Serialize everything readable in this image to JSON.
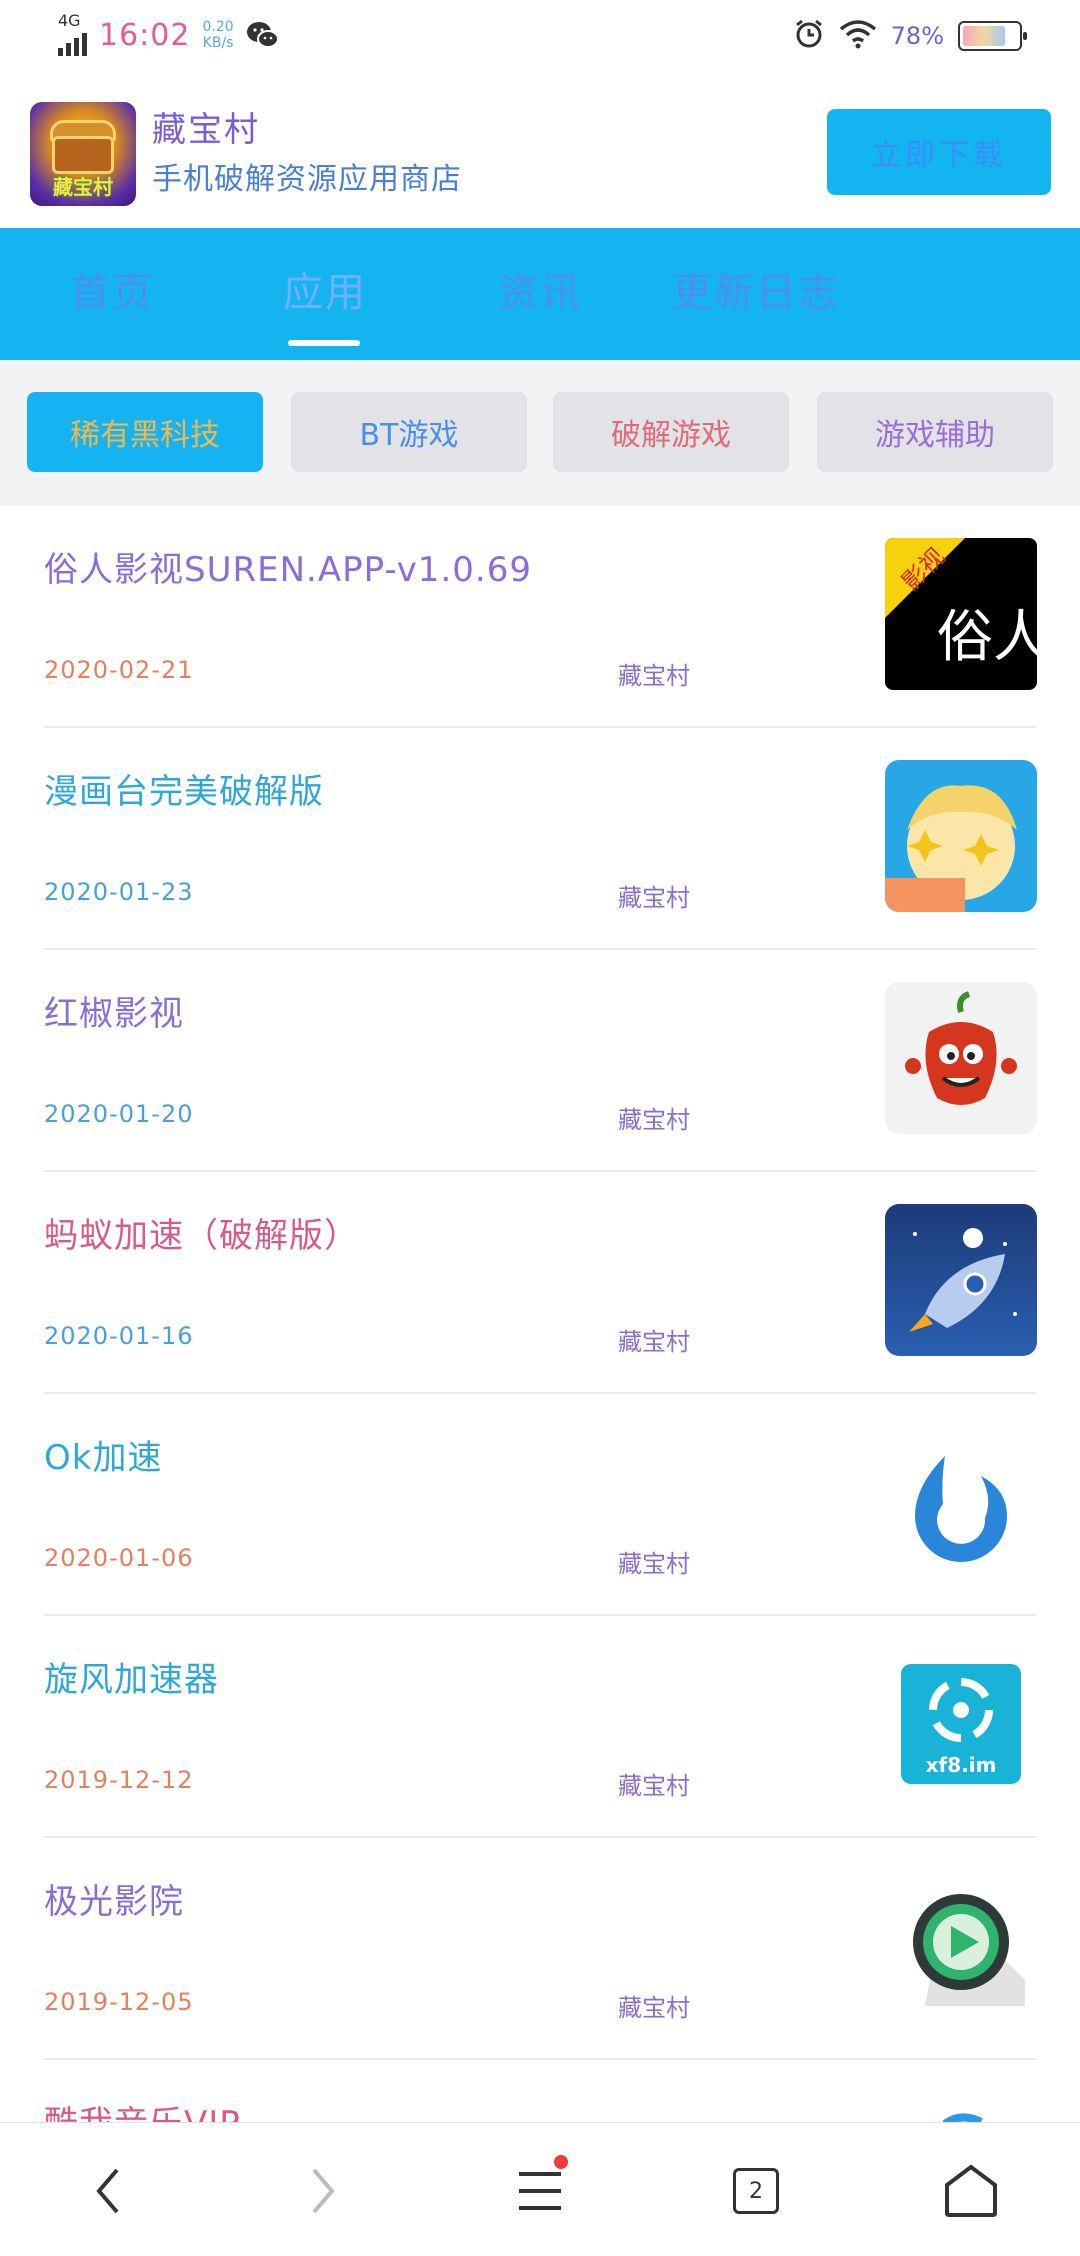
{
  "status_bar": {
    "network": "4G",
    "time": "16:02",
    "speed_value": "0.20",
    "speed_unit": "KB/s",
    "battery_percent": "78%",
    "battery_level": 0.78
  },
  "app": {
    "logo_text": "藏宝村",
    "name": "藏宝村",
    "tagline": "手机破解资源应用商店",
    "download_label": "立即下载"
  },
  "nav": {
    "items": [
      {
        "label": "首页"
      },
      {
        "label": "应用"
      },
      {
        "label": "资讯"
      },
      {
        "label": "更新日志"
      }
    ],
    "active_index": 1
  },
  "categories": [
    {
      "label": "稀有黑科技"
    },
    {
      "label": "BT游戏"
    },
    {
      "label": "破解游戏"
    },
    {
      "label": "游戏辅助"
    }
  ],
  "apps": [
    {
      "title": "俗人影视SUREN.APP-v1.0.69",
      "date": "2020-02-21",
      "source": "藏宝村",
      "icon": "suren-icon",
      "badge": "影视",
      "icon_text": "俗人"
    },
    {
      "title": "漫画台完美破解版",
      "date": "2020-01-23",
      "source": "藏宝村",
      "icon": "manhuatai-icon"
    },
    {
      "title": "红椒影视",
      "date": "2020-01-20",
      "source": "藏宝村",
      "icon": "pepper-icon"
    },
    {
      "title": "蚂蚁加速（破解版）",
      "date": "2020-01-16",
      "source": "藏宝村",
      "icon": "rocket-icon"
    },
    {
      "title": "Ok加速",
      "date": "2020-01-06",
      "source": "藏宝村",
      "icon": "ok-drop-icon"
    },
    {
      "title": "旋风加速器",
      "date": "2019-12-12",
      "source": "藏宝村",
      "icon": "xuanfeng-icon",
      "icon_text": "xf8.im"
    },
    {
      "title": "极光影院",
      "date": "2019-12-05",
      "source": "藏宝村",
      "icon": "play-icon"
    },
    {
      "title": "酷我音乐VIP",
      "date": "",
      "source": "",
      "icon": "kuwo-icon"
    }
  ],
  "colors": {
    "brand_blue": "#14b4f1",
    "accent_orange": "#f2b94a",
    "notification_red": "#ee3a3a"
  },
  "bottom_bar": {
    "tab_count": "2"
  }
}
